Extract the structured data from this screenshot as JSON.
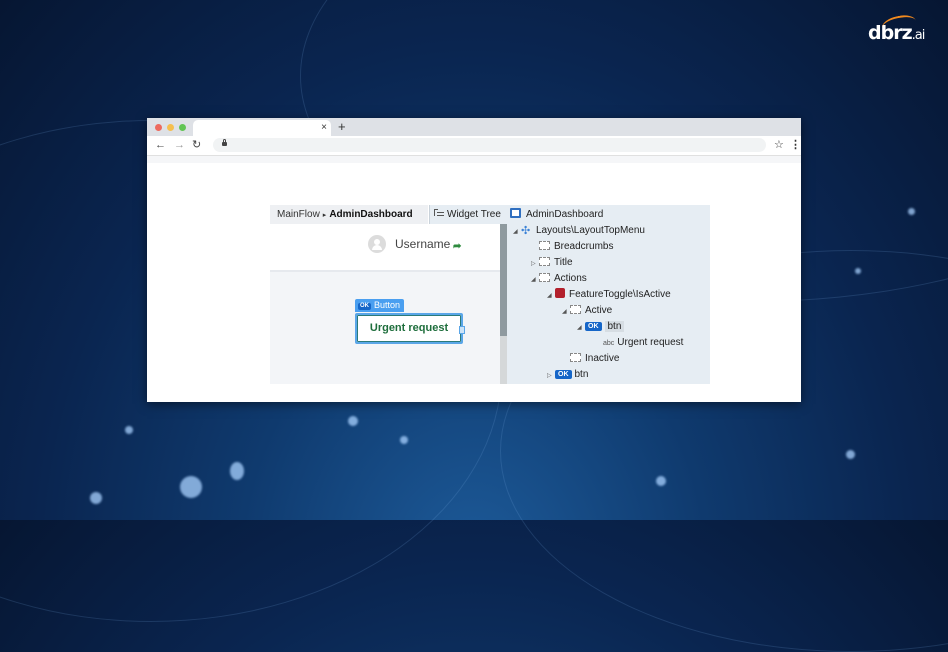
{
  "brand": {
    "name": "dbrz",
    "suffix": ".ai",
    "accent": "#f28a1e"
  },
  "browser": {
    "tab_title": "",
    "tab_close": "×",
    "new_tab": "+",
    "back": "←",
    "forward": "→",
    "reload": "↻",
    "url": "",
    "bookmark": "☆",
    "menu": "⋮"
  },
  "studio": {
    "breadcrumb": {
      "parent": "MainFlow",
      "separator": "▸",
      "current": "AdminDashboard"
    },
    "widget_tree_tab": "Widget Tree",
    "header": {
      "username": "Username",
      "logout_icon": "➦"
    },
    "selected_widget": {
      "type_badge": "OK",
      "type_label": "Button",
      "text": "Urgent request"
    },
    "tree": [
      {
        "label": "AdminDashboard",
        "icon": "screen-icon",
        "toggle": ""
      },
      {
        "label": "Layouts\\LayoutTopMenu",
        "icon": "layout-block-icon",
        "toggle": "◢"
      },
      {
        "label": "Breadcrumbs",
        "icon": "placeholder-icon",
        "toggle": ""
      },
      {
        "label": "Title",
        "icon": "placeholder-icon",
        "toggle": "▷"
      },
      {
        "label": "Actions",
        "icon": "placeholder-icon",
        "toggle": "◢"
      },
      {
        "label": "FeatureToggle\\IsActive",
        "icon": "feature-toggle-icon",
        "toggle": "◢"
      },
      {
        "label": "Active",
        "icon": "placeholder-icon",
        "toggle": "◢"
      },
      {
        "label": "btn",
        "icon": "button-icon",
        "toggle": "◢",
        "badge": "OK",
        "selected": true
      },
      {
        "label": "Urgent request",
        "icon": "text-icon",
        "icon_text": "abc",
        "toggle": ""
      },
      {
        "label": "Inactive",
        "icon": "placeholder-icon",
        "toggle": ""
      },
      {
        "label": "btn",
        "icon": "button-icon",
        "toggle": "▷",
        "badge": "OK"
      }
    ]
  }
}
